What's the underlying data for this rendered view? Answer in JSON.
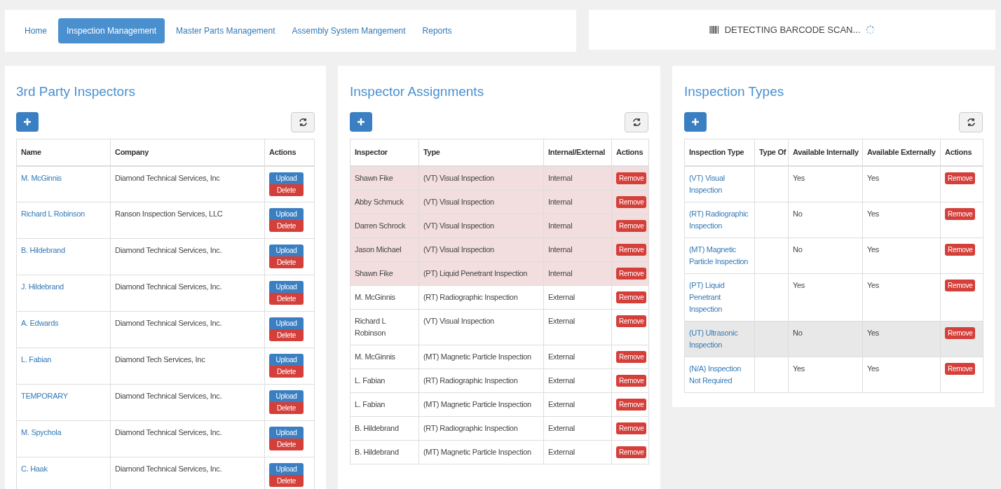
{
  "nav": {
    "items": [
      {
        "label": "Home",
        "selected": false
      },
      {
        "label": "Inspection Management",
        "selected": true
      },
      {
        "label": "Master Parts Management",
        "selected": false
      },
      {
        "label": "Assembly System Mangement",
        "selected": false
      },
      {
        "label": "Reports",
        "selected": false
      }
    ]
  },
  "scanner": {
    "status": "DETECTING BARCODE SCAN..."
  },
  "inspectors": {
    "title": "3rd Party Inspectors",
    "columns": [
      "Name",
      "Company",
      "Actions"
    ],
    "rows": [
      {
        "name": "M. McGinnis",
        "company": "Diamond Technical Services, Inc",
        "upload_label": "Upload",
        "delete_label": "Delete"
      },
      {
        "name": "Richard L Robinson",
        "company": "Ranson Inspection Services, LLC",
        "upload_label": "Upload",
        "delete_label": "Delete"
      },
      {
        "name": "B. Hildebrand",
        "company": "Diamond Technical Services, Inc.",
        "upload_label": "Upload",
        "delete_label": "Delete"
      },
      {
        "name": "J. Hildebrand",
        "company": "Diamond Technical Services, Inc.",
        "upload_label": "Upload",
        "delete_label": "Delete"
      },
      {
        "name": "A. Edwards",
        "company": "Diamond Technical Services, Inc.",
        "upload_label": "Upload",
        "delete_label": "Delete"
      },
      {
        "name": "L. Fabian",
        "company": "Diamond Tech Services, Inc",
        "upload_label": "Upload",
        "delete_label": "Delete"
      },
      {
        "name": "TEMPORARY",
        "company": "Diamond Technical Services, Inc.",
        "upload_label": "Upload",
        "delete_label": "Delete"
      },
      {
        "name": "M. Spychola",
        "company": "Diamond Technical Services, Inc.",
        "upload_label": "Upload",
        "delete_label": "Delete"
      },
      {
        "name": "C. Haak",
        "company": "Diamond Technical Services, Inc.",
        "upload_label": "Upload",
        "delete_label": "Delete"
      }
    ]
  },
  "assignments": {
    "title": "Inspector Assignments",
    "columns": [
      "Inspector",
      "Type",
      "Internal/External",
      "Actions"
    ],
    "rows": [
      {
        "inspector": "Shawn Fike",
        "type": "(VT) Visual Inspection",
        "scope": "Internal",
        "highlighted": true,
        "remove_label": "Remove"
      },
      {
        "inspector": "Abby Schmuck",
        "type": "(VT) Visual Inspection",
        "scope": "Internal",
        "highlighted": true,
        "remove_label": "Remove"
      },
      {
        "inspector": "Darren Schrock",
        "type": "(VT) Visual Inspection",
        "scope": "Internal",
        "highlighted": true,
        "remove_label": "Remove"
      },
      {
        "inspector": "Jason Michael",
        "type": "(VT) Visual Inspection",
        "scope": "Internal",
        "highlighted": true,
        "remove_label": "Remove"
      },
      {
        "inspector": "Shawn Fike",
        "type": "(PT) Liquid Penetrant Inspection",
        "scope": "Internal",
        "highlighted": true,
        "remove_label": "Remove"
      },
      {
        "inspector": "M. McGinnis",
        "type": "(RT) Radiographic Inspection",
        "scope": "External",
        "highlighted": false,
        "remove_label": "Remove"
      },
      {
        "inspector": "Richard L Robinson",
        "type": "(VT) Visual Inspection",
        "scope": "External",
        "highlighted": false,
        "remove_label": "Remove"
      },
      {
        "inspector": "M. McGinnis",
        "type": "(MT) Magnetic Particle Inspection",
        "scope": "External",
        "highlighted": false,
        "remove_label": "Remove"
      },
      {
        "inspector": "L. Fabian",
        "type": "(RT) Radiographic Inspection",
        "scope": "External",
        "highlighted": false,
        "remove_label": "Remove"
      },
      {
        "inspector": "L. Fabian",
        "type": "(MT) Magnetic Particle Inspection",
        "scope": "External",
        "highlighted": false,
        "remove_label": "Remove"
      },
      {
        "inspector": "B. Hildebrand",
        "type": "(RT) Radiographic Inspection",
        "scope": "External",
        "highlighted": false,
        "remove_label": "Remove"
      },
      {
        "inspector": "B. Hildebrand",
        "type": "(MT) Magnetic Particle Inspection",
        "scope": "External",
        "highlighted": false,
        "remove_label": "Remove"
      }
    ]
  },
  "types": {
    "title": "Inspection Types",
    "columns": [
      "Inspection Type",
      "Type Of",
      "Available Internally",
      "Available Externally",
      "Actions"
    ],
    "rows": [
      {
        "name": "(VT) Visual Inspection",
        "internal": "Yes",
        "external": "Yes",
        "highlighted": false,
        "remove_label": "Remove"
      },
      {
        "name": "(RT) Radiographic Inspection",
        "internal": "No",
        "external": "Yes",
        "highlighted": false,
        "remove_label": "Remove"
      },
      {
        "name": "(MT) Magnetic Particle Inspection",
        "internal": "No",
        "external": "Yes",
        "highlighted": false,
        "remove_label": "Remove"
      },
      {
        "name": "(PT) Liquid Penetrant Inspection",
        "internal": "Yes",
        "external": "Yes",
        "highlighted": false,
        "remove_label": "Remove"
      },
      {
        "name": "(UT) Ultrasonic Inspection",
        "internal": "No",
        "external": "Yes",
        "highlighted": true,
        "remove_label": "Remove"
      },
      {
        "name": "(N/A) Inspection Not Required",
        "internal": "Yes",
        "external": "Yes",
        "highlighted": false,
        "remove_label": "Remove"
      }
    ]
  }
}
